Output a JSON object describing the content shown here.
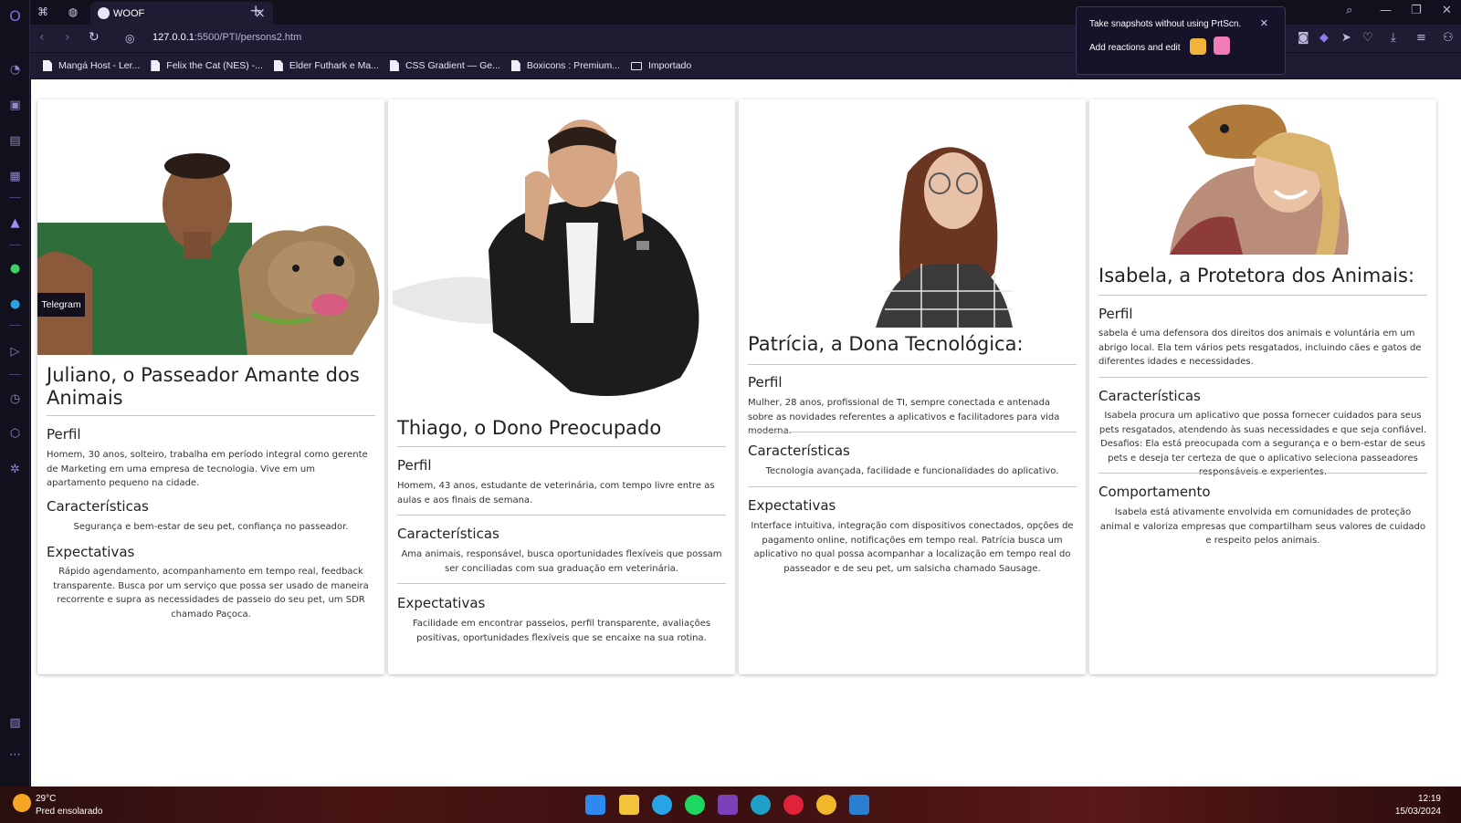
{
  "browser": {
    "tab_title": "WOOF",
    "url_host": "127.0.0.1",
    "url_path": ":5500/PTI/persons2.htm",
    "bookmarks": [
      {
        "label": "Mangá Host - Ler...",
        "type": "page"
      },
      {
        "label": "Felix the Cat (NES) -...",
        "type": "page"
      },
      {
        "label": "Elder Futhark e Ma...",
        "type": "page"
      },
      {
        "label": "CSS Gradient — Ge...",
        "type": "page"
      },
      {
        "label": "Boxicons : Premium...",
        "type": "page"
      },
      {
        "label": "Importado",
        "type": "folder"
      }
    ],
    "popup": {
      "line1": "Take snapshots without using PrtScn.",
      "line2": "Add reactions and edit"
    },
    "sidebar_tooltip": "Telegram"
  },
  "personas": [
    {
      "name": "Juliano, o Passeador Amante dos Animais",
      "perfil_label": "Perfil",
      "perfil": "Homem, 30 anos, solteiro, trabalha em período integral como gerente de Marketing em uma empresa de tecnologia. Vive em um apartamento pequeno na cidade.",
      "caracteristicas_label": "Características",
      "caracteristicas": "Segurança e bem-estar de seu pet, confiança no passeador.",
      "expectativas_label": "Expectativas",
      "expectativas": "Rápido agendamento, acompanhamento em tempo real, feedback transparente. Busca por um serviço que possa ser usado de maneira recorrente e supra as necessidades de passeio do seu pet, um SDR chamado Paçoca."
    },
    {
      "name": "Thiago, o Dono Preocupado",
      "perfil_label": "Perfil",
      "perfil": "Homem, 43 anos, estudante de veterinária, com tempo livre entre as aulas e aos finais de semana.",
      "caracteristicas_label": "Características",
      "caracteristicas": "Ama animais, responsável, busca oportunidades flexíveis que possam ser conciliadas com sua graduação em veterinária.",
      "expectativas_label": "Expectativas",
      "expectativas": "Facilidade em encontrar passeios, perfil transparente, avaliações positivas, oportunidades flexíveis que se encaixe na sua rotina."
    },
    {
      "name": "Patrícia, a Dona Tecnológica:",
      "perfil_label": "Perfil",
      "perfil": "Mulher, 28 anos, profissional de TI, sempre conectada e antenada sobre as novidades referentes a aplicativos e facilitadores para vida moderna.",
      "caracteristicas_label": "Características",
      "caracteristicas": "Tecnologia avançada, facilidade e funcionalidades do aplicativo.",
      "expectativas_label": "Expectativas",
      "expectativas": "Interface intuitiva, integração com dispositivos conectados, opções de pagamento online, notificações em tempo real. Patrícia busca um aplicativo no qual possa acompanhar a localização em tempo real do passeador e de seu pet, um salsicha chamado Sausage."
    },
    {
      "name": "Isabela, a Protetora dos Animais:",
      "perfil_label": "Perfil",
      "perfil": "sabela é uma defensora dos direitos dos animais e voluntária em um abrigo local. Ela tem vários pets resgatados, incluindo cães e gatos de diferentes idades e necessidades.",
      "caracteristicas_label": "Características",
      "caracteristicas": "Isabela procura um aplicativo que possa fornecer cuidados para seus pets resgatados, atendendo às suas necessidades e que seja confiável. Desafios: Ela está preocupada com a segurança e o bem-estar de seus pets e deseja ter certeza de que o aplicativo seleciona passeadores responsáveis e experientes.",
      "comportamento_label": "Comportamento",
      "comportamento": "Isabela está ativamente envolvida em comunidades de proteção animal e valoriza empresas que compartilham seus valores de cuidado e respeito pelos animais."
    }
  ],
  "taskbar": {
    "temperature": "29°C",
    "weather": "Pred ensolarado",
    "time": "12:19",
    "date": "15/03/2024"
  }
}
